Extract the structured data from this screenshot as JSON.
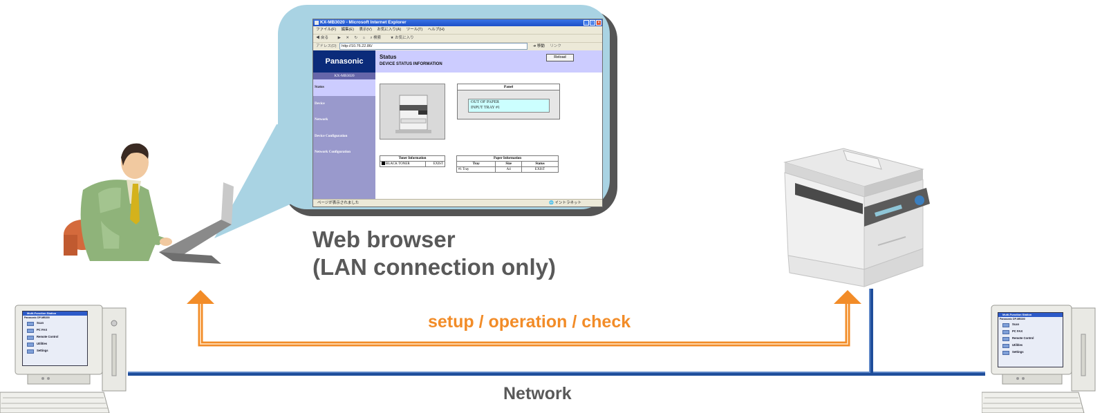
{
  "browser": {
    "window_title": "KX-MB3020 - Microsoft Internet Explorer",
    "menu": [
      "ファイル(F)",
      "編集(E)",
      "表示(V)",
      "お気に入り(A)",
      "ツール(T)",
      "ヘルプ(H)"
    ],
    "toolbar": [
      "戻る",
      "検索",
      "お気に入り"
    ],
    "address_label": "アドレス(D)",
    "address_url": "http://10.76.22.86/",
    "go_label": "移動",
    "links_label": "リンク",
    "status_text": "ページが表示されました",
    "zone_text": "イントラネット"
  },
  "web_page": {
    "brand": "Panasonic",
    "model": "KX-MB3020",
    "nav": [
      "Status",
      "Device",
      "Network",
      "Device Configuration",
      "Network Configuration"
    ],
    "active_nav": "Status",
    "title": "Status",
    "subtitle": "DEVICE STATUS INFORMATION",
    "reload_label": "Reload",
    "panel": {
      "heading": "Panel",
      "line1": "OUT OF PAPER",
      "line2": "INPUT TRAY #1"
    },
    "toner": {
      "heading": "Toner Information",
      "item": "BLACK TONER",
      "status": "EXIST"
    },
    "paper": {
      "heading": "Paper Information",
      "columns": [
        "Tray",
        "Size",
        "Status"
      ],
      "rows": [
        [
          "#1 Tray",
          "A4",
          "EXIST"
        ]
      ]
    }
  },
  "caption": {
    "line1": "Web browser",
    "line2": "(LAN connection only)"
  },
  "flow_label": "setup / operation / check",
  "network_label": "Network",
  "pc_screen": {
    "title": "Multi-Function Station",
    "model": "Panasonic DP-MB300",
    "items": [
      "Scan",
      "PC FAX",
      "Remote Control",
      "Utilities",
      "Settings"
    ]
  },
  "colors": {
    "arrow": "#f28c28",
    "network_line": "#1f4e9b",
    "callout": "#a9d3e3",
    "caption": "#595959"
  }
}
